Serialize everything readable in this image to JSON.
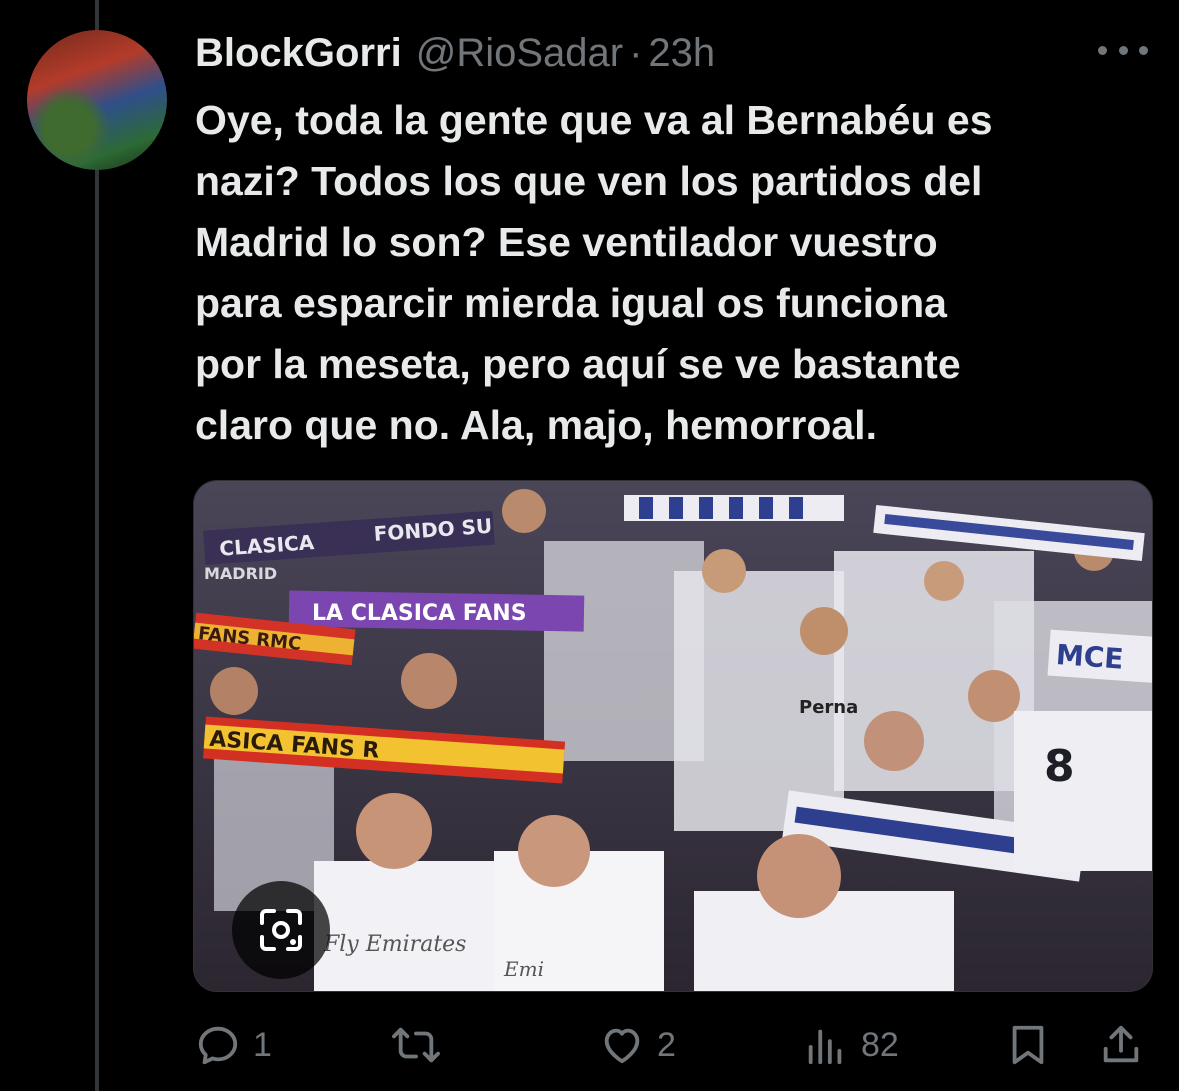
{
  "tweet": {
    "display_name": "BlockGorri",
    "handle": "@RioSadar",
    "separator": "·",
    "time": "23h",
    "text": "Oye, toda la gente que va al Bernabéu es\nnazi? Todos los que ven los partidos del\nMadrid lo son? Ese ventilador vuestro\npara esparcir mierda igual os funciona\npor la meseta, pero aquí se ve bastante\nclaro que no. Ala, majo, hemorroal."
  },
  "media": {
    "banners": {
      "clasica_top": "CLASICA",
      "fondo_sur": "FONDO SU",
      "madrid": "MADRID",
      "la_clasica_fans": "LA CLASICA FANS",
      "fans_rmc": "FANS RMC",
      "clasica_fans_r": "ASICA FANS R",
      "mce": "MCE"
    },
    "shirts": {
      "sponsor": "Fly Emirates",
      "partial": "Emi",
      "perna": "Perna",
      "number": "8"
    },
    "lens_icon": "google-lens-icon"
  },
  "actions": {
    "reply": {
      "icon": "reply-icon",
      "count": "1"
    },
    "retweet": {
      "icon": "retweet-icon",
      "count": ""
    },
    "like": {
      "icon": "heart-icon",
      "count": "2"
    },
    "views": {
      "icon": "views-icon",
      "count": "82"
    },
    "bookmark": {
      "icon": "bookmark-icon"
    },
    "share": {
      "icon": "share-icon"
    }
  },
  "colors": {
    "background": "#000000",
    "text": "#e7e9ea",
    "secondary": "#71767b",
    "scarf_red": "#c8281e",
    "scarf_yellow": "#f2c230",
    "scarf_purple": "#6b3a9e",
    "scarf_blue": "#2f3f8f"
  }
}
